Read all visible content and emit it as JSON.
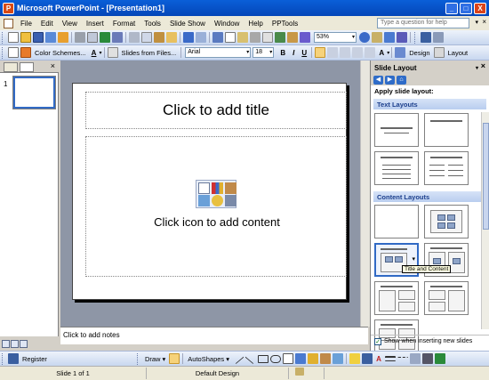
{
  "window": {
    "title": "Microsoft PowerPoint - [Presentation1]",
    "app_icon_letter": "P",
    "minimize": "_",
    "maximize": "□",
    "close": "X"
  },
  "menu": {
    "items": [
      "File",
      "Edit",
      "View",
      "Insert",
      "Format",
      "Tools",
      "Slide Show",
      "Window",
      "Help",
      "PPTools"
    ],
    "help_placeholder": "Type a question for help",
    "help_arrow": "▾",
    "mdi_close": "×"
  },
  "standard_toolbar": {
    "zoom": "53%",
    "dropdown": "▾"
  },
  "formatting_toolbar": {
    "color_schemes": "Color Schemes...",
    "slides_from_files": "Slides from Files...",
    "font": "Arial",
    "font_size": "18",
    "bold": "B",
    "italic": "I",
    "underline": "U",
    "font_color_glyph": "A",
    "design": "Design",
    "layout": "Layout"
  },
  "slides_pane": {
    "close": "×",
    "slide_number": "1"
  },
  "slide": {
    "title_placeholder": "Click to add title",
    "content_placeholder": "Click icon to add content"
  },
  "notes": {
    "placeholder": "Click to add notes"
  },
  "task_pane": {
    "title": "Slide Layout",
    "dropdown": "▾",
    "close": "×",
    "apply_label": "Apply slide layout:",
    "text_layouts_header": "Text Layouts",
    "content_layouts_header": "Content Layouts",
    "tooltip": "Title and Content",
    "show_when_inserting": "Show when inserting new slides",
    "checkmark": "✓"
  },
  "draw_toolbar": {
    "register": "Register",
    "draw": "Draw ▾",
    "autoshapes": "AutoShapes ▾"
  },
  "status_bar": {
    "slide_position": "Slide 1 of 1",
    "design_name": "Default Design"
  }
}
